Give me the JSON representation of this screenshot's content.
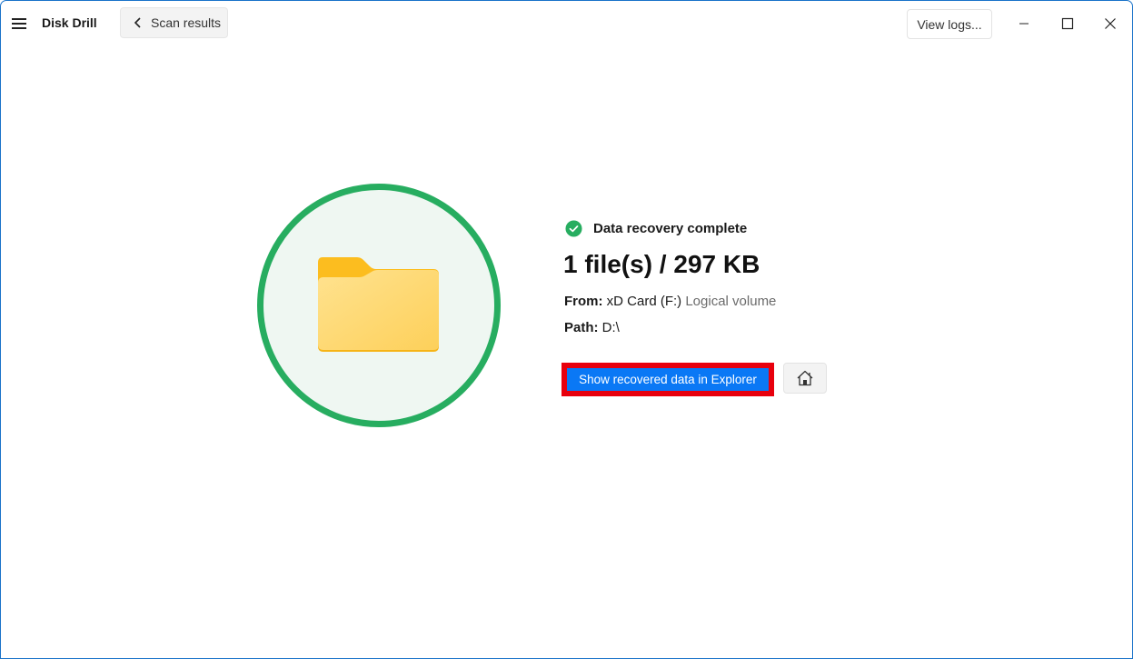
{
  "app": {
    "title": "Disk Drill"
  },
  "toolbar": {
    "back_label": "Scan results",
    "view_logs_label": "View logs..."
  },
  "window_controls": {
    "minimize": "minimize-icon",
    "maximize": "maximize-icon",
    "close": "close-icon"
  },
  "result": {
    "status": "Data recovery complete",
    "summary": "1 file(s) / 297 KB",
    "from_label": "From:",
    "from_device": "xD Card (F:)",
    "from_type": "Logical volume",
    "path_label": "Path:",
    "path_value": "D:\\",
    "show_button_label": "Show recovered data in Explorer",
    "home_button_icon": "home-icon"
  },
  "colors": {
    "accent_blue": "#0a78f5",
    "success_green": "#27ad60",
    "highlight_red": "#e8000d",
    "folder_yellow": "#fcbd1f"
  }
}
